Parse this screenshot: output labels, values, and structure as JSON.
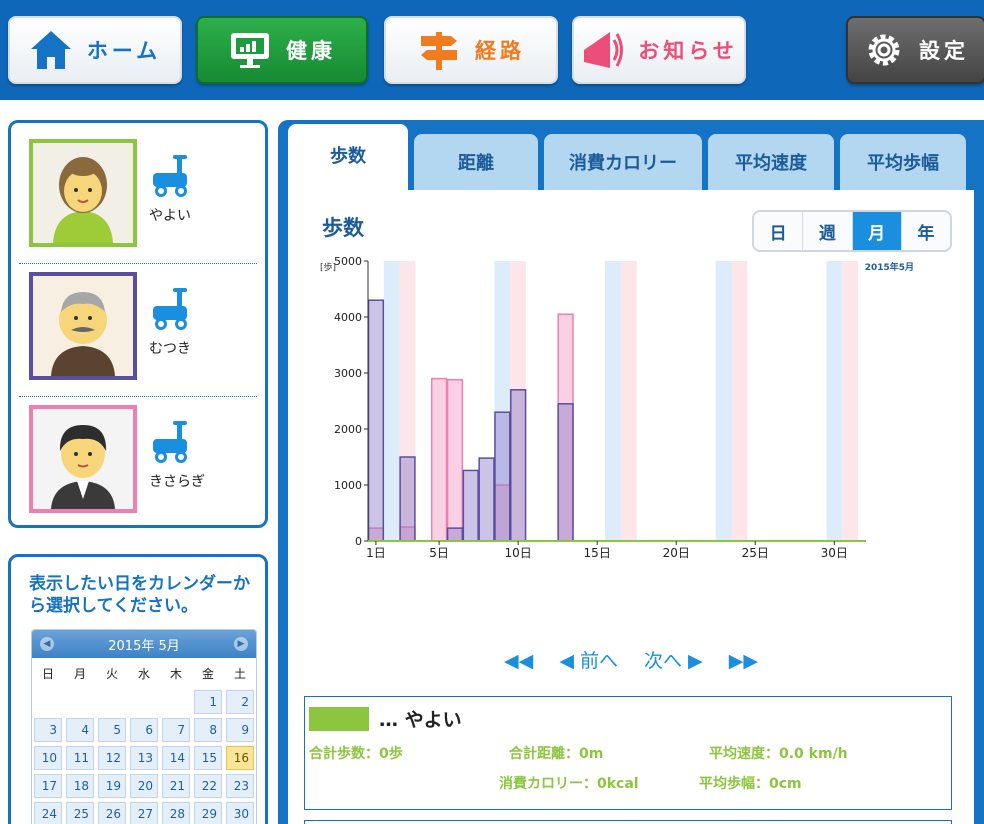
{
  "nav": {
    "home_label": "ホーム",
    "health_label": "健康",
    "route_label": "経路",
    "notice_label": "お知らせ",
    "settings_label": "設定"
  },
  "users": [
    {
      "name": "やよい",
      "color": "#8cc63f"
    },
    {
      "name": "むつき",
      "color": "#5b4ea0"
    },
    {
      "name": "きさらぎ",
      "color": "#ef7fb1"
    }
  ],
  "calendar": {
    "instruction": "表示したい日をカレンダーから選択してください。",
    "month_label": "2015年 5月",
    "weekdays": [
      "日",
      "月",
      "火",
      "水",
      "木",
      "金",
      "土"
    ],
    "leading_blank_days": 5,
    "visible_days": [
      1,
      2,
      3,
      4,
      5,
      6,
      7,
      8,
      9,
      10,
      11,
      12,
      13,
      14,
      15,
      16,
      17,
      18,
      19,
      20,
      21,
      22,
      23,
      24,
      25,
      26,
      27,
      28,
      29,
      30
    ],
    "selected_day": 16
  },
  "tabs": [
    "歩数",
    "距離",
    "消費カロリー",
    "平均速度",
    "平均歩幅"
  ],
  "active_tab": "歩数",
  "chart_header": {
    "title": "歩数",
    "periods": [
      "日",
      "週",
      "月",
      "年"
    ],
    "active_period": "月",
    "unit_label": "[歩]",
    "month_label": "2015年5月"
  },
  "chart_data": {
    "type": "bar",
    "title": "歩数",
    "ylabel": "[歩]",
    "xlabel": "",
    "ylim": [
      0,
      5000
    ],
    "yticks": [
      0,
      1000,
      2000,
      3000,
      4000,
      5000
    ],
    "xlim": [
      1,
      31
    ],
    "xticks": [
      1,
      5,
      10,
      15,
      20,
      25,
      30
    ],
    "xtick_labels": [
      "1日",
      "5日",
      "10日",
      "15日",
      "20日",
      "25日",
      "30日"
    ],
    "x_period_label": "2015年5月",
    "weekend_shading": {
      "saturdays": [
        2,
        9,
        16,
        23,
        30
      ],
      "sundays": [
        3,
        10,
        17,
        24,
        31
      ],
      "saturday_color": "#dcecfb",
      "sunday_color": "#fde6ea"
    },
    "series": [
      {
        "name": "やよい",
        "color": "#8cc63f",
        "x": [],
        "values": []
      },
      {
        "name": "むつき",
        "color": "#5b4ea0",
        "x": [
          1,
          3,
          6,
          7,
          8,
          9,
          10,
          13
        ],
        "values": [
          4300,
          1500,
          230,
          1260,
          1480,
          2300,
          2700,
          2450
        ]
      },
      {
        "name": "きさらぎ",
        "color": "#ef7fb1",
        "x": [
          1,
          3,
          5,
          6,
          9,
          13
        ],
        "values": [
          230,
          250,
          2900,
          2880,
          1000,
          4050
        ]
      }
    ]
  },
  "pager": {
    "first": "◀◀",
    "prev": "◀ 前へ",
    "next": "次へ ▶",
    "last": "▶▶"
  },
  "summary": {
    "legend_name": "… やよい",
    "total_steps": "合計歩数：0歩",
    "total_distance": "合計距離：0m",
    "avg_speed": "平均速度：0.0 km/h",
    "calories": "消費カロリー：0kcal",
    "avg_stride": "平均歩幅：0cm"
  }
}
